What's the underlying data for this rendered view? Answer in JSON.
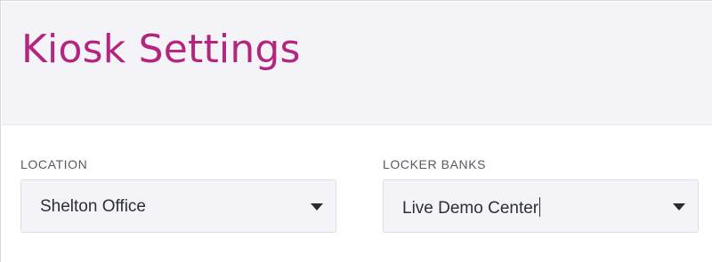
{
  "header": {
    "title": "Kiosk Settings"
  },
  "fields": {
    "location": {
      "label": "LOCATION",
      "value": "Shelton Office"
    },
    "locker_banks": {
      "label": "LOCKER BANKS",
      "value": "Live Demo Center"
    }
  },
  "icons": {
    "dropdown": "caret-down-icon"
  },
  "colors": {
    "title": "#b3257f",
    "header_bg": "#f4f4f8",
    "label": "#555a62",
    "text": "#2b2f36"
  }
}
